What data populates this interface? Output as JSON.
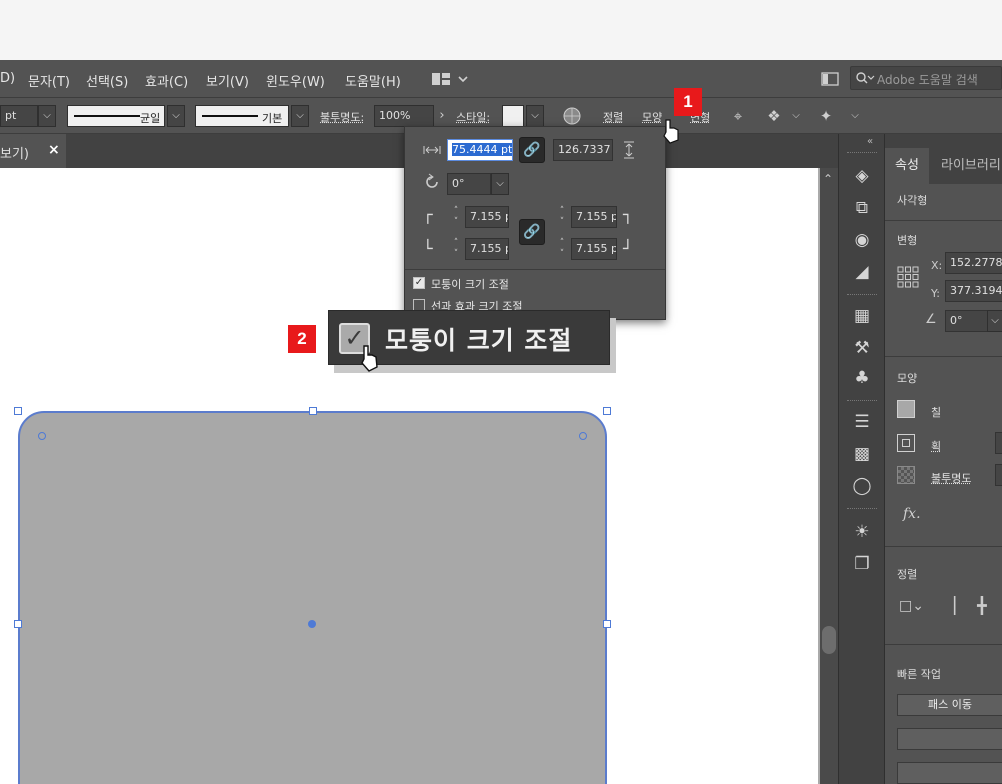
{
  "colors": {
    "accent": "#e8191b",
    "selection": "#4e7ad6",
    "shape_fill": "#a8a8a8"
  },
  "menu": {
    "items": [
      "D)",
      "문자(T)",
      "선택(S)",
      "효과(C)",
      "보기(V)",
      "윈도우(W)",
      "도움말(H)"
    ],
    "search_placeholder": "Adobe 도움말 검색"
  },
  "control": {
    "unit": "pt",
    "stroke_profile": "균일",
    "brush": "기본",
    "opacity_label": "불투명도:",
    "opacity_value": "100%",
    "style_label": "스타일:",
    "align_label": "정렬",
    "shape_label": "모양",
    "transform_label": "변형"
  },
  "document_tab": {
    "label": "보기)",
    "close": "×"
  },
  "popup": {
    "width": "75.4444 pt",
    "height": "126.7337 p",
    "rotation": "0°",
    "corner_tl": "7.155 p",
    "corner_tr": "7.155 p",
    "corner_bl": "7.155 p",
    "corner_br": "7.155 p",
    "scale_corners_label": "모퉁이 크기 조절",
    "scale_strokes_label": "선과 효과 크기 조절",
    "scale_corners_checked": true
  },
  "callout": {
    "label": "모퉁이 크기 조절"
  },
  "badges": {
    "first": "1",
    "second": "2"
  },
  "panel": {
    "tab_properties": "속성",
    "tab_libraries": "라이브러리",
    "object_type": "사각형",
    "transform_header": "변형",
    "x_label": "X:",
    "x_value": "152.2778",
    "y_label": "Y:",
    "y_value": "377.3194",
    "angle_value": "0°",
    "appearance_header": "모양",
    "fill_label": "칠",
    "stroke_label": "획",
    "opacity_label": "불투명도",
    "fx_label": "fx.",
    "align_header": "정렬",
    "quick_actions_header": "빠른 작업",
    "offset_path_button": "패스 이동"
  }
}
